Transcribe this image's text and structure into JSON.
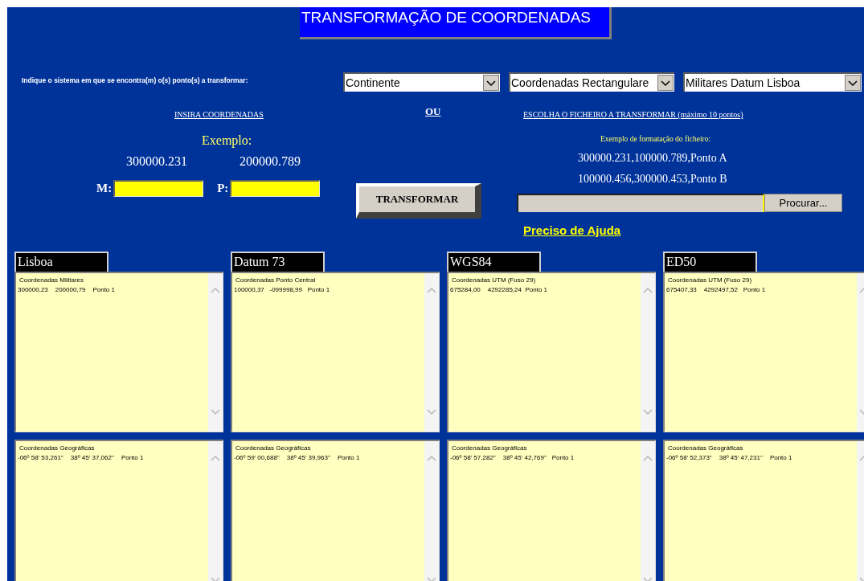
{
  "title": "TRANSFORMAÇÃO DE COORDENADAS",
  "system_prompt": "Indique o sistema em que se encontra(m) o(s) ponto(s) a transformar:",
  "selects": [
    {
      "value": "Continente"
    },
    {
      "value": "Coordenadas Rectangulare"
    },
    {
      "value": "Militares Datum Lisboa"
    }
  ],
  "manual": {
    "heading": "INSIRA COORDENADAS",
    "example_label": "Exemplo:",
    "example_values": [
      "300000.231",
      "200000.789"
    ],
    "fields": [
      {
        "label": "M:"
      },
      {
        "label": "P:"
      }
    ]
  },
  "or_label": "OU",
  "transform_button": "TRANSFORMAR",
  "file": {
    "heading": "ESCOLHA O FICHEIRO A TRANSFORMAR (máximo 10 pontos)",
    "example_label": "Exemplo de formatação do ficheiro:",
    "example_lines": [
      "300000.231,100000.789,Ponto A",
      "100000.456,300000.453,Ponto B"
    ],
    "browse_button": "Procurar..."
  },
  "help_link": "Preciso de Ajuda",
  "datums": [
    {
      "name": "Lisboa",
      "panels": [
        {
          "heading": "Coordenadas Militares",
          "line": "300000,23    200000,79    Ponto 1"
        },
        {
          "heading": "Coordenadas Geográficas",
          "line": "-06º 58' 53,261''    38º 45' 37,062''    Ponto 1"
        }
      ]
    },
    {
      "name": "Datum 73",
      "panels": [
        {
          "heading": "Coordenadas Ponto Central",
          "line": "100000,37   -099998,99   Ponto 1"
        },
        {
          "heading": "Coordenadas Geográficas",
          "line": "-06º 59' 00,688''    38º 45' 39,963''    Ponto 1"
        }
      ]
    },
    {
      "name": "WGS84",
      "panels": [
        {
          "heading": "Coordenadas UTM (Fuso 29)",
          "line": "675284,00    4292285,24  Ponto 1"
        },
        {
          "heading": "Coordenadas Geográficas",
          "line": "-06º 58' 57,282''    38º 45' 42,769''   Ponto 1"
        }
      ]
    },
    {
      "name": "ED50",
      "panels": [
        {
          "heading": "Coordenadas UTM (Fuso 29)",
          "line": "675407,33    4292497,52   Ponto 1"
        },
        {
          "heading": "Coordenadas Geográficas",
          "line": "-06º 58' 52,373''    38º 45' 47,231''    Ponto 1"
        }
      ]
    }
  ]
}
